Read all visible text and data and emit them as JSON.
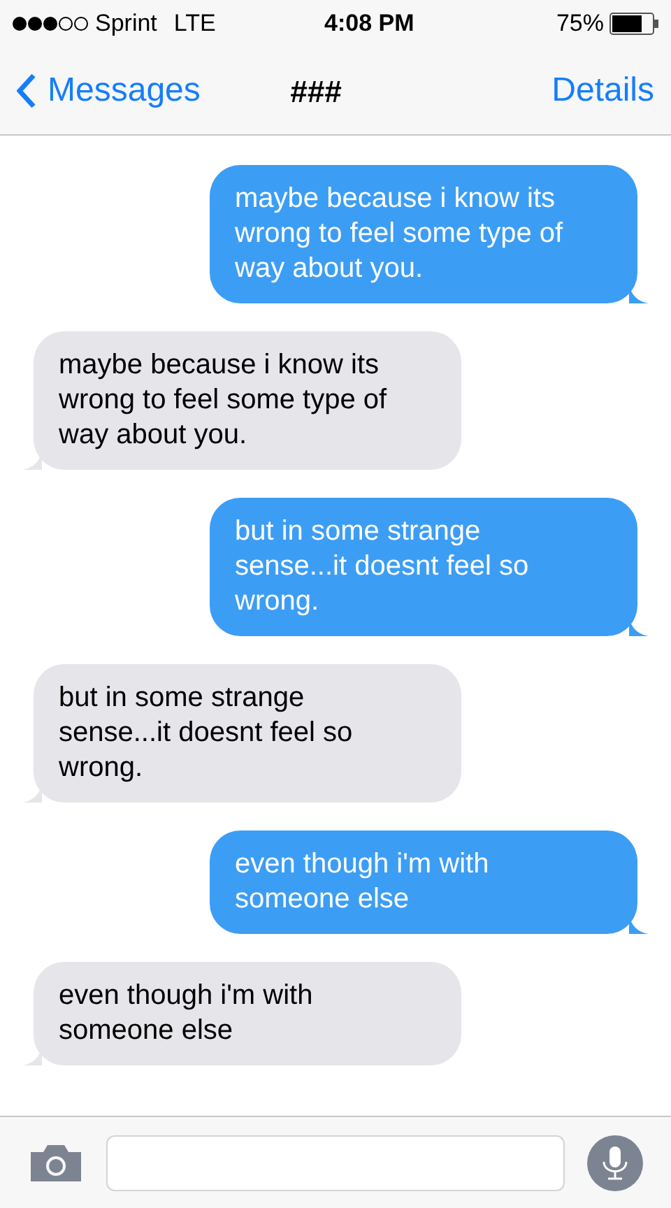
{
  "status_bar": {
    "carrier": "Sprint",
    "network": "LTE",
    "time": "4:08 PM",
    "battery": "75%"
  },
  "nav": {
    "back": "Messages",
    "title": "###",
    "action": "Details"
  },
  "messages": [
    {
      "text": "maybe because i know its wrong to feel some type of way about you.",
      "kind": "sent"
    },
    {
      "text": "maybe because i know its wrong to feel some type of way about you.",
      "kind": "received"
    },
    {
      "text": "but in some strange sense...it doesnt feel so wrong.",
      "kind": "sent"
    },
    {
      "text": "but in some strange sense...it doesnt feel so wrong.",
      "kind": "received"
    },
    {
      "text": "even though i'm with someone else",
      "kind": "sent"
    },
    {
      "text": "even though i'm with someone else",
      "kind": "received"
    }
  ]
}
